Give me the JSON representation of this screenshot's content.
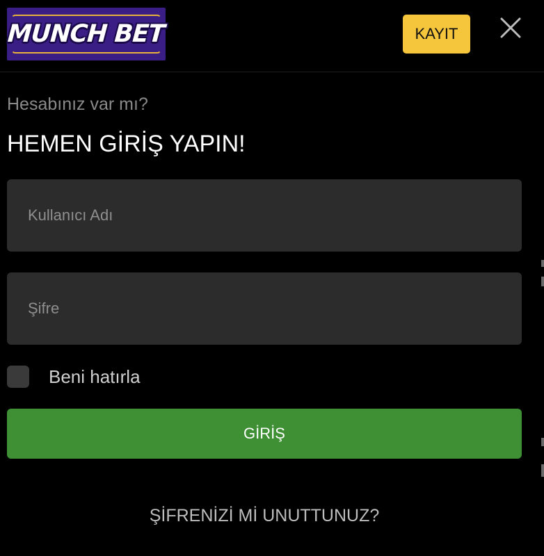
{
  "header": {
    "logo_text": "MUNCH BET",
    "register_label": "KAYIT",
    "close_icon": "close-icon"
  },
  "login": {
    "subtitle": "Hesabınız var mı?",
    "title": "HEMEN GİRİŞ YAPIN!",
    "username_placeholder": "Kullanıcı Adı",
    "username_value": "",
    "password_placeholder": "Şifre",
    "password_value": "",
    "remember_label": "Beni hatırla",
    "remember_checked": false,
    "submit_label": "GİRİŞ",
    "forgot_label": "ŞİFRENİZİ Mİ UNUTTUNUZ?"
  },
  "colors": {
    "background": "#000000",
    "register_button": "#f5c53b",
    "login_button": "#3f9035",
    "field_background": "#2c2c2c",
    "logo_background": "#3b1d86"
  }
}
